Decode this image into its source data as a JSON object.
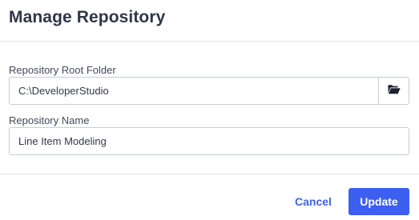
{
  "dialog": {
    "title": "Manage Repository"
  },
  "form": {
    "root_folder": {
      "label": "Repository Root Folder",
      "value": "C:\\DeveloperStudio",
      "browse_icon": "folder-open-icon"
    },
    "repository_name": {
      "label": "Repository Name",
      "value": "Line Item Modeling"
    }
  },
  "footer": {
    "cancel_label": "Cancel",
    "update_label": "Update"
  },
  "colors": {
    "accent": "#3d5ff0",
    "link": "#3d64e6",
    "title": "#2f3747",
    "border": "#c8ccd6"
  }
}
